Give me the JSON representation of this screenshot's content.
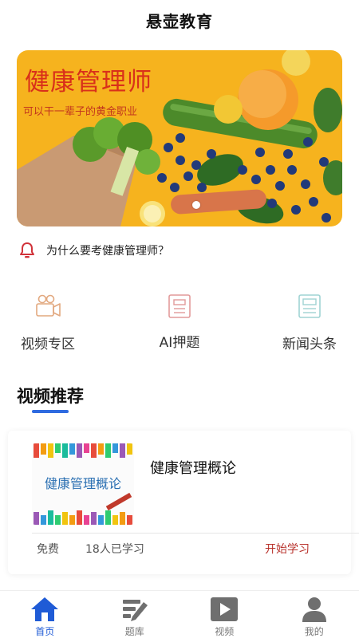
{
  "header": {
    "title": "悬壶教育"
  },
  "banner": {
    "title": "健康管理师",
    "subtitle": "可以干一辈子的黄金职业",
    "colors": {
      "background": "#f6b31e",
      "title": "#d9301a"
    }
  },
  "notice": {
    "icon": "bell-icon",
    "text": "为什么要考健康管理师？"
  },
  "quick_links": [
    {
      "icon": "video-camera-icon",
      "label": "视频专区"
    },
    {
      "icon": "document-icon",
      "label": "AI押题"
    },
    {
      "icon": "newspaper-icon",
      "label": "新闻头条"
    }
  ],
  "section": {
    "title": "视频推荐"
  },
  "course": {
    "thumb_title": "健康管理概论",
    "name": "健康管理概论",
    "price_tag": "免费",
    "learners": "18人已学习",
    "action": "开始学习"
  },
  "tabbar": {
    "items": [
      {
        "icon": "home-icon",
        "label": "首页",
        "active": true
      },
      {
        "icon": "question-bank-icon",
        "label": "题库",
        "active": false
      },
      {
        "icon": "play-icon",
        "label": "视频",
        "active": false
      },
      {
        "icon": "user-icon",
        "label": "我的",
        "active": false
      }
    ]
  },
  "colors": {
    "accent": "#1f5bd6",
    "action": "#b8312b"
  }
}
